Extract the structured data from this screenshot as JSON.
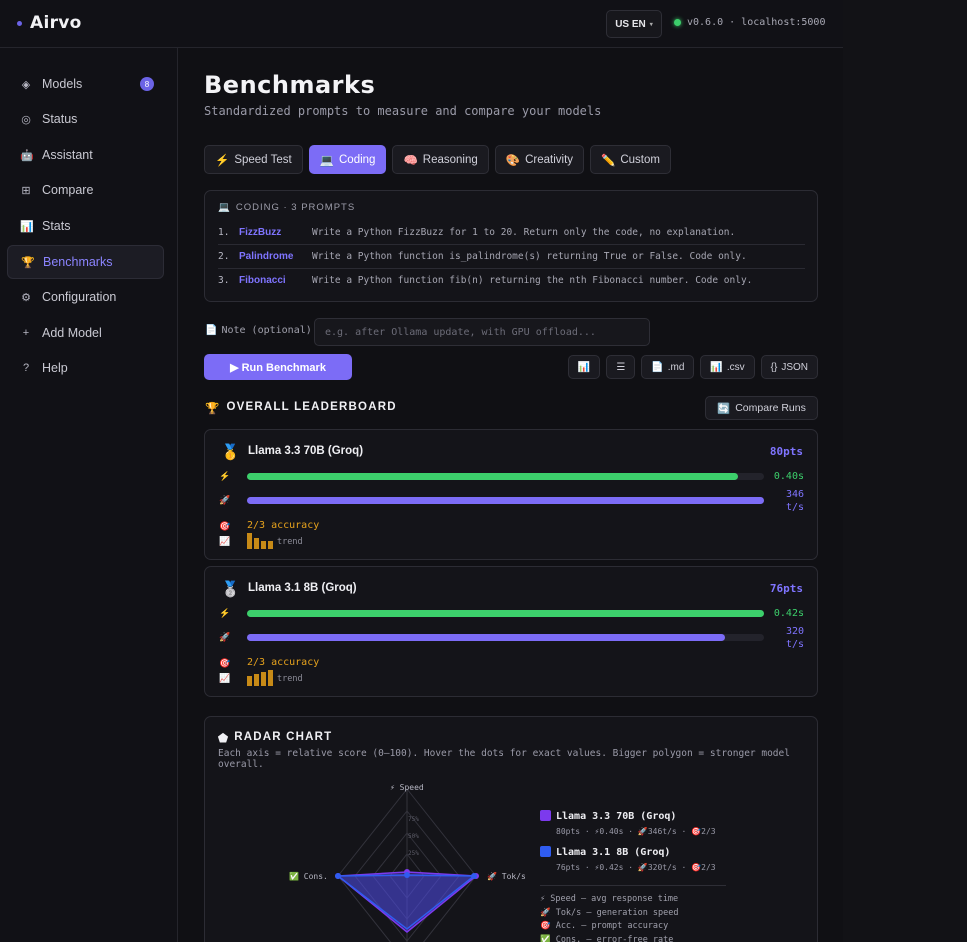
{
  "app": {
    "name": "Airvo",
    "lang": "US EN",
    "version": "v0.6.0 · localhost:5000"
  },
  "sidebar": {
    "items": [
      {
        "icon": "◈",
        "label": "Models",
        "badge": "8"
      },
      {
        "icon": "◎",
        "label": "Status"
      },
      {
        "icon": "🤖",
        "label": "Assistant"
      },
      {
        "icon": "⊞",
        "label": "Compare"
      },
      {
        "icon": "📊",
        "label": "Stats"
      },
      {
        "icon": "🏆",
        "label": "Benchmarks",
        "active": true
      },
      {
        "icon": "⚙",
        "label": "Configuration"
      },
      {
        "icon": "+",
        "label": "Add Model"
      },
      {
        "icon": "?",
        "label": "Help"
      }
    ]
  },
  "page": {
    "title": "Benchmarks",
    "subtitle": "Standardized prompts to measure and compare your models"
  },
  "tabs": [
    {
      "icon": "⚡",
      "label": "Speed Test"
    },
    {
      "icon": "💻",
      "label": "Coding",
      "active": true
    },
    {
      "icon": "🧠",
      "label": "Reasoning"
    },
    {
      "icon": "🎨",
      "label": "Creativity"
    },
    {
      "icon": "✏️",
      "label": "Custom"
    }
  ],
  "prompts": {
    "icon": "💻",
    "header": "CODING · 3 PROMPTS",
    "items": [
      {
        "num": "1.",
        "name": "FizzBuzz",
        "text": "Write a Python FizzBuzz for 1 to 20. Return only the code, no explanation."
      },
      {
        "num": "2.",
        "name": "Palindrome",
        "text": "Write a Python function is_palindrome(s) returning True or False. Code only."
      },
      {
        "num": "3.",
        "name": "Fibonacci",
        "text": "Write a Python function fib(n) returning the nth Fibonacci number. Code only."
      }
    ]
  },
  "note": {
    "icon": "📄",
    "label": "Note (optional):",
    "placeholder": "e.g. after Ollama update, with GPU offload..."
  },
  "actions": {
    "run": "▶ Run Benchmark",
    "exports": [
      {
        "icon": "📊",
        "label": ""
      },
      {
        "icon": "☰",
        "label": ""
      },
      {
        "icon": "📄",
        "label": ".md"
      },
      {
        "icon": "📊",
        "label": ".csv"
      },
      {
        "icon": "{}",
        "label": "JSON"
      }
    ]
  },
  "leaderboard": {
    "icon": "🏆",
    "title": "OVERALL LEADERBOARD",
    "compare_icon": "🔄",
    "compare_label": "Compare Runs",
    "entries": [
      {
        "medal": "🥇",
        "name": "Llama 3.3 70B (Groq)",
        "points": "80pts",
        "time": "0.40s",
        "time_fill": 0.95,
        "tps": "346",
        "tps_unit": "t/s",
        "tps_fill": 1.0,
        "accuracy": "2/3 accuracy",
        "trend_label": "trend",
        "trend": [
          16,
          11,
          8,
          8
        ]
      },
      {
        "medal": "🥈",
        "name": "Llama 3.1 8B (Groq)",
        "points": "76pts",
        "time": "0.42s",
        "time_fill": 1.0,
        "tps": "320",
        "tps_unit": "t/s",
        "tps_fill": 0.925,
        "accuracy": "2/3 accuracy",
        "trend_label": "trend",
        "trend": [
          10,
          12,
          14,
          16
        ]
      }
    ],
    "row_icons": {
      "time": "⚡",
      "tps": "🚀",
      "acc": "🎯",
      "trend": "📈"
    }
  },
  "radar": {
    "icon": "⬟",
    "title": "RADAR CHART",
    "subtitle": "Each axis = relative score (0–100). Hover the dots for exact values. Bigger polygon = stronger model overall.",
    "axes": {
      "speed": "⚡ Speed",
      "tps": "🚀 Tok/s",
      "cons": "✅ Cons."
    },
    "ticks": [
      "75%",
      "50%",
      "25%"
    ],
    "models": [
      {
        "name": "Llama 3.3 70B (Groq)",
        "color": "#7c3aed",
        "meta": "80pts · ⚡0.40s · 🚀346t/s · 🎯2/3"
      },
      {
        "name": "Llama 3.1 8B (Groq)",
        "color": "#2f5cf0",
        "meta": "76pts · ⚡0.42s · 🚀320t/s · 🎯2/3"
      }
    ],
    "notes": [
      "⚡ Speed — avg response time",
      "🚀 Tok/s — generation speed",
      "🎯 Acc. — prompt accuracy",
      "✅ Cons. — error-free rate"
    ]
  }
}
